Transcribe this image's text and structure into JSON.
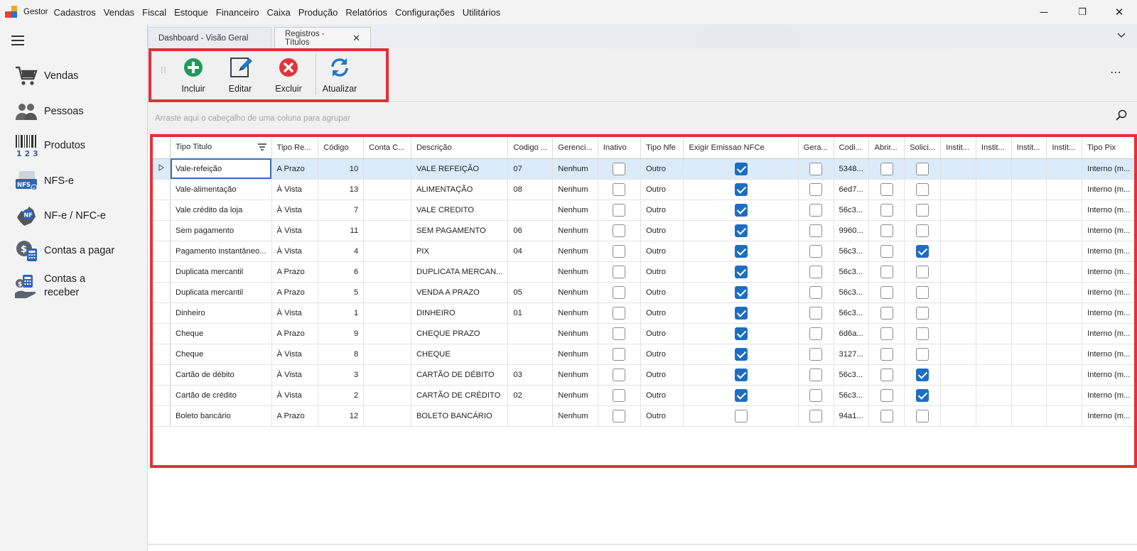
{
  "app": {
    "name": "Gestor"
  },
  "menu": [
    "Cadastros",
    "Vendas",
    "Fiscal",
    "Estoque",
    "Financeiro",
    "Caixa",
    "Produção",
    "Relatórios",
    "Configurações",
    "Utilitários"
  ],
  "window_controls": {
    "minimize": "─",
    "restore": "❐",
    "close": "✕"
  },
  "sidebar": {
    "items": [
      {
        "label": "Vendas",
        "icon": "shopping-cart-icon"
      },
      {
        "label": "Pessoas",
        "icon": "people-icon"
      },
      {
        "label": "Produtos",
        "icon": "barcode-icon"
      },
      {
        "label": "NFS-e",
        "icon": "nfse-icon"
      },
      {
        "label": "NF-e / NFC-e",
        "icon": "nfe-icon"
      },
      {
        "label": "Contas a pagar",
        "icon": "pay-bills-icon"
      },
      {
        "label": "Contas a receber",
        "icon": "receive-bills-icon"
      }
    ]
  },
  "tabs": [
    {
      "label": "Dashboard - Visão Geral",
      "active": false
    },
    {
      "label": "Registros - Títulos",
      "active": true,
      "close": "✕"
    }
  ],
  "toolbar": {
    "incluir": "Incluir",
    "editar": "Editar",
    "excluir": "Excluir",
    "atualizar": "Atualizar",
    "more": "⋯"
  },
  "groupbar": {
    "placeholder": "Arraste aqui o cabeçalho de uma coluna para agrupar"
  },
  "grid": {
    "columns": [
      "Tipo Titulo",
      "Tipo Re...",
      "Código",
      "Conta C...",
      "Descrição",
      "Codigo ...",
      "Gerenci...",
      "Inativo",
      "Tipo Nfe",
      "Exigir Emissao NFCe",
      "Gera...",
      "Codi...",
      "Abrir...",
      "Solici...",
      "Instit...",
      "Instit...",
      "Instit...",
      "Instit...",
      "Tipo Pix"
    ],
    "rows": [
      {
        "tipo": "Vale-refeição",
        "rec": "A Prazo",
        "codigo": "10",
        "conta": "",
        "desc": "VALE REFEIÇÃO",
        "cod2": "07",
        "ger": "Nenhum",
        "inativo": false,
        "nfe": "Outro",
        "nfce": true,
        "gera": false,
        "codi": "5348...",
        "abrir": false,
        "solic": false,
        "pix": "Interno (m..."
      },
      {
        "tipo": "Vale-alimentação",
        "rec": "À Vista",
        "codigo": "13",
        "conta": "",
        "desc": "ALIMENTAÇÃO",
        "cod2": "08",
        "ger": "Nenhum",
        "inativo": false,
        "nfe": "Outro",
        "nfce": true,
        "gera": false,
        "codi": "6ed7...",
        "abrir": false,
        "solic": false,
        "pix": "Interno (m..."
      },
      {
        "tipo": "Vale crédito da loja",
        "rec": "À Vista",
        "codigo": "7",
        "conta": "",
        "desc": "VALE CREDITO",
        "cod2": "",
        "ger": "Nenhum",
        "inativo": false,
        "nfe": "Outro",
        "nfce": true,
        "gera": false,
        "codi": "56c3...",
        "abrir": false,
        "solic": false,
        "pix": "Interno (m..."
      },
      {
        "tipo": "Sem pagamento",
        "rec": "À Vista",
        "codigo": "11",
        "conta": "",
        "desc": "SEM PAGAMENTO",
        "cod2": "06",
        "ger": "Nenhum",
        "inativo": false,
        "nfe": "Outro",
        "nfce": true,
        "gera": false,
        "codi": "9960...",
        "abrir": false,
        "solic": false,
        "pix": "Interno (m..."
      },
      {
        "tipo": "Pagamento instantâneo...",
        "rec": "À Vista",
        "codigo": "4",
        "conta": "",
        "desc": "PIX",
        "cod2": "04",
        "ger": "Nenhum",
        "inativo": false,
        "nfe": "Outro",
        "nfce": true,
        "gera": false,
        "codi": "56c3...",
        "abrir": false,
        "solic": true,
        "pix": "Interno (m..."
      },
      {
        "tipo": "Duplicata mercantil",
        "rec": "A Prazo",
        "codigo": "6",
        "conta": "",
        "desc": "DUPLICATA MERCAN...",
        "cod2": "",
        "ger": "Nenhum",
        "inativo": false,
        "nfe": "Outro",
        "nfce": true,
        "gera": false,
        "codi": "56c3...",
        "abrir": false,
        "solic": false,
        "pix": "Interno (m..."
      },
      {
        "tipo": "Duplicata mercantil",
        "rec": "A Prazo",
        "codigo": "5",
        "conta": "",
        "desc": "VENDA A PRAZO",
        "cod2": "05",
        "ger": "Nenhum",
        "inativo": false,
        "nfe": "Outro",
        "nfce": true,
        "gera": false,
        "codi": "56c3...",
        "abrir": false,
        "solic": false,
        "pix": "Interno (m..."
      },
      {
        "tipo": "Dinheiro",
        "rec": "À Vista",
        "codigo": "1",
        "conta": "",
        "desc": "DINHEIRO",
        "cod2": "01",
        "ger": "Nenhum",
        "inativo": false,
        "nfe": "Outro",
        "nfce": true,
        "gera": false,
        "codi": "56c3...",
        "abrir": false,
        "solic": false,
        "pix": "Interno (m..."
      },
      {
        "tipo": "Cheque",
        "rec": "A Prazo",
        "codigo": "9",
        "conta": "",
        "desc": "CHEQUE PRAZO",
        "cod2": "",
        "ger": "Nenhum",
        "inativo": false,
        "nfe": "Outro",
        "nfce": true,
        "gera": false,
        "codi": "6d6a...",
        "abrir": false,
        "solic": false,
        "pix": "Interno (m..."
      },
      {
        "tipo": "Cheque",
        "rec": "À Vista",
        "codigo": "8",
        "conta": "",
        "desc": "CHEQUE",
        "cod2": "",
        "ger": "Nenhum",
        "inativo": false,
        "nfe": "Outro",
        "nfce": true,
        "gera": false,
        "codi": "3127...",
        "abrir": false,
        "solic": false,
        "pix": "Interno (m..."
      },
      {
        "tipo": "Cartão de débito",
        "rec": "À Vista",
        "codigo": "3",
        "conta": "",
        "desc": "CARTÃO DE DÉBITO",
        "cod2": "03",
        "ger": "Nenhum",
        "inativo": false,
        "nfe": "Outro",
        "nfce": true,
        "gera": false,
        "codi": "56c3...",
        "abrir": false,
        "solic": true,
        "pix": "Interno (m..."
      },
      {
        "tipo": "Cartão de crédito",
        "rec": "À Vista",
        "codigo": "2",
        "conta": "",
        "desc": "CARTÃO DE CRÉDITO",
        "cod2": "02",
        "ger": "Nenhum",
        "inativo": false,
        "nfe": "Outro",
        "nfce": true,
        "gera": false,
        "codi": "56c3...",
        "abrir": false,
        "solic": true,
        "pix": "Interno (m..."
      },
      {
        "tipo": "Boleto bancário",
        "rec": "A Prazo",
        "codigo": "12",
        "conta": "",
        "desc": "BOLETO BANCÁRIO",
        "cod2": "",
        "ger": "Nenhum",
        "inativo": false,
        "nfe": "Outro",
        "nfce": false,
        "gera": false,
        "codi": "94a1...",
        "abrir": false,
        "solic": false,
        "pix": "Interno (m..."
      }
    ]
  },
  "colors": {
    "accent": "#1b6ec2",
    "highlight": "#e2303a",
    "green": "#1f9a5b",
    "red": "#e0343b",
    "blue": "#1e78c8"
  }
}
